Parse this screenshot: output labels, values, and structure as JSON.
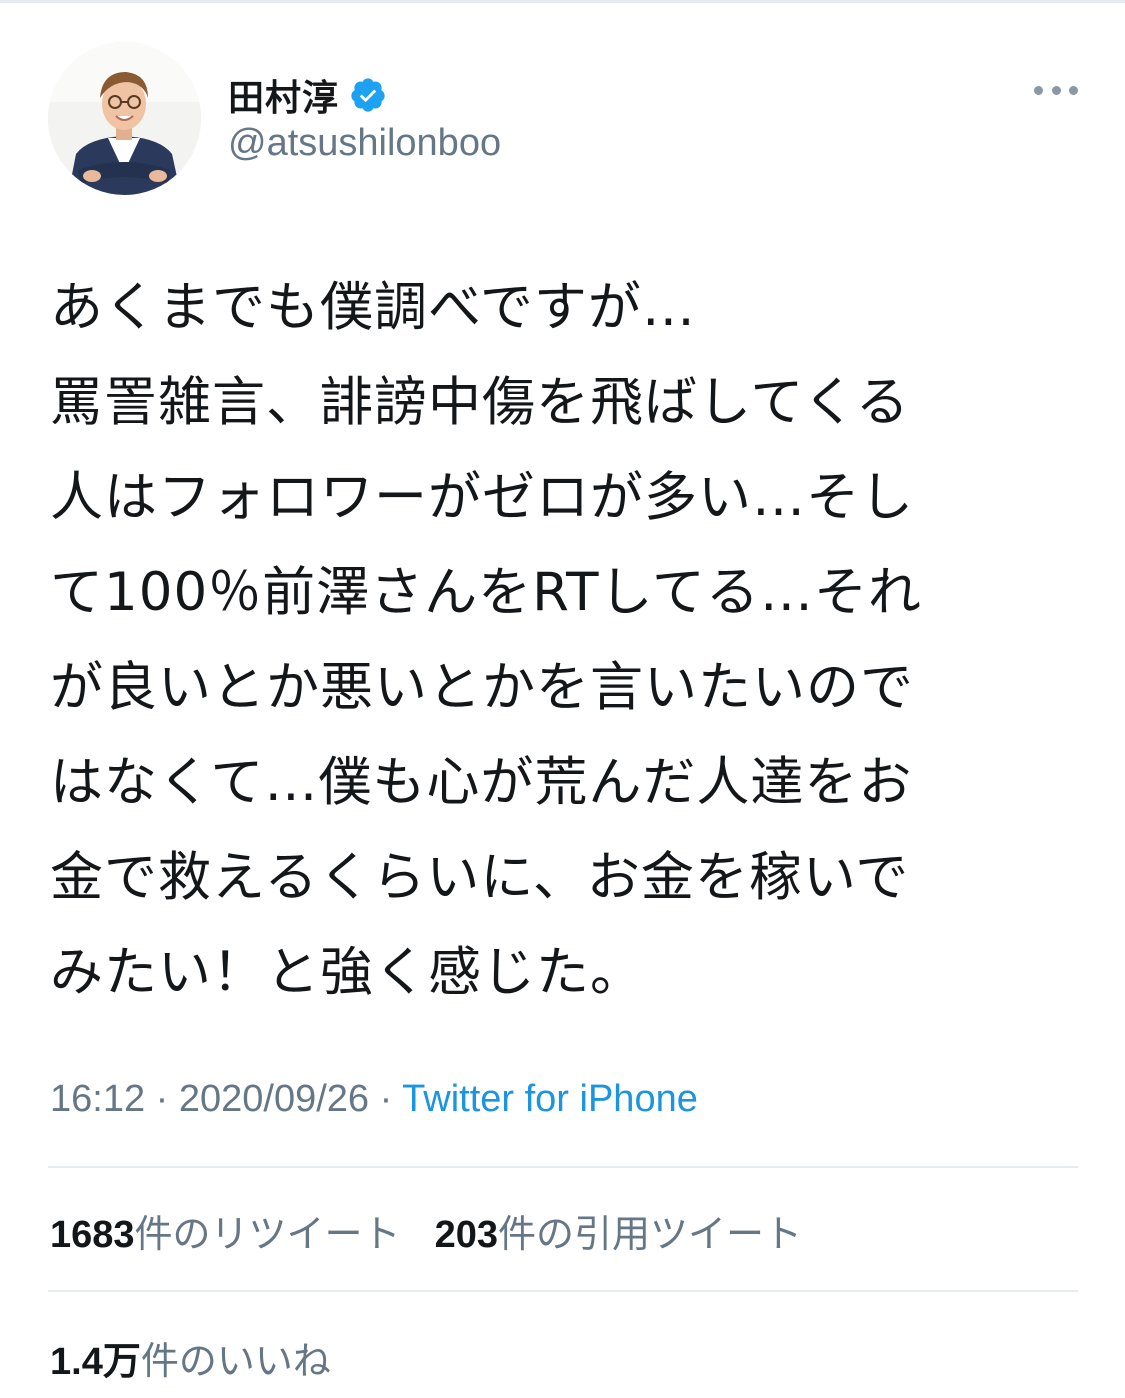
{
  "user": {
    "display_name": "田村淳",
    "handle": "@atsushilonboo",
    "verified": true
  },
  "icons": {
    "verified": "verified-badge-icon",
    "more": "more-dots-icon"
  },
  "colors": {
    "link_blue": "#1b95e0",
    "verified_blue": "#1da1f2",
    "secondary_text": "#657786"
  },
  "tweet": {
    "text": "あくまでも僕調べですが…\n罵詈雑言、誹謗中傷を飛ばしてくる\n人はフォロワーがゼロが多い…そし\nて100％前澤さんをRTしてる…それ\nが良いとか悪いとかを言いたいので\nはなくて…僕も心が荒んだ人達をお\n金で救えるくらいに、お金を稼いで\nみたい！と強く感じた。"
  },
  "meta": {
    "time": "16:12",
    "separator": " · ",
    "date": "2020/09/26",
    "source": "Twitter for iPhone"
  },
  "stats": {
    "retweets_count": "1683",
    "retweets_label": "件のリツイート",
    "quotes_count": "203",
    "quotes_label": "件の引用ツイート",
    "likes_count": "1.4万",
    "likes_label": "件のいいね"
  }
}
